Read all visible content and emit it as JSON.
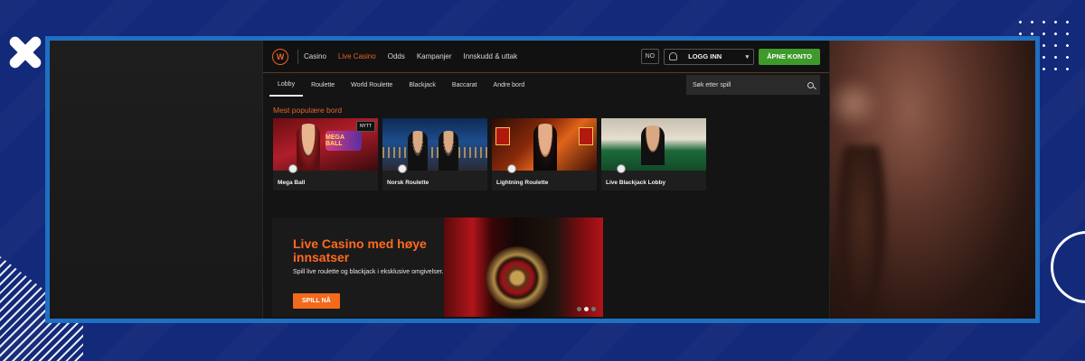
{
  "nav": {
    "logo": "W",
    "links": [
      "Casino",
      "Live Casino",
      "Odds",
      "Kampanjer",
      "Innskudd & uttak"
    ],
    "language": "NO",
    "login_label": "LOGG INN",
    "open_account_label": "ÅPNE KONTO"
  },
  "subnav": {
    "tabs": [
      "Lobby",
      "Roulette",
      "World Roulette",
      "Blackjack",
      "Baccarat",
      "Andre bord"
    ],
    "search_placeholder": "Søk etter spill"
  },
  "popular": {
    "title": "Mest populære bord",
    "cards": [
      {
        "title": "Mega Ball",
        "badge": "NYTT",
        "logo": "MEGA BALL"
      },
      {
        "title": "Norsk Roulette"
      },
      {
        "title": "Lightning Roulette"
      },
      {
        "title": "Live Blackjack Lobby"
      }
    ]
  },
  "banner": {
    "title": "Live Casino med høye innsatser",
    "text": "Spill live roulette og blackjack i eksklusive omgivelser.",
    "cta": "SPILL NÅ",
    "slides": 3,
    "active_slide": 2
  },
  "colors": {
    "accent": "#e8622a",
    "cta_green": "#3f9a2c",
    "frame": "#1f6fc2",
    "background": "#13297a"
  }
}
